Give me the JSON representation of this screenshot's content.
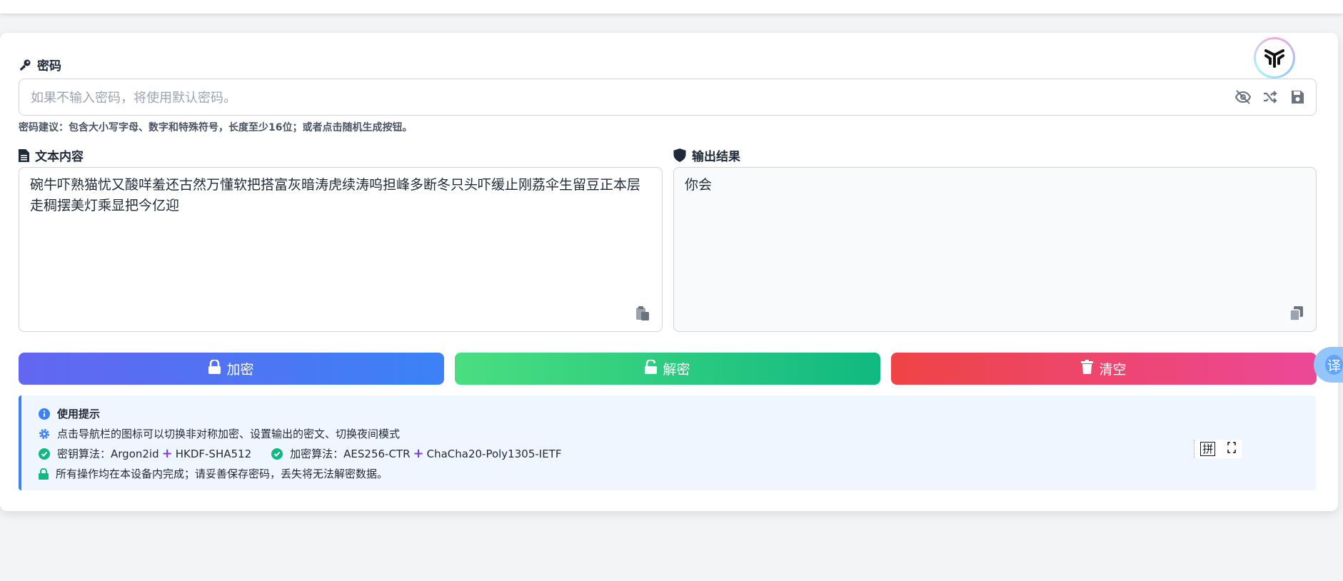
{
  "password": {
    "label": "密码",
    "placeholder": "如果不输入密码，将使用默认密码。",
    "hint": "密码建议：包含大小写字母、数字和特殊符号，长度至少16位；或者点击随机生成按钮。",
    "icons": [
      "eye-slash-icon",
      "shuffle-icon",
      "save-icon"
    ]
  },
  "input_panel": {
    "label": "文本内容",
    "value": "碗牛吓熟猫忧又酸咩羞还古然万懂软把搭富灰暗涛虎续涛呜担峰多断冬只头吓缓止刚荔伞生留豆正本层走稠摆美灯乘显把今亿迎"
  },
  "output_panel": {
    "label": "输出结果",
    "value": "你会"
  },
  "buttons": {
    "encrypt": "加密",
    "decrypt": "解密",
    "clear": "清空"
  },
  "tips": {
    "title": "使用提示",
    "line1": "点击导航栏的图标可以切换非对称加密、设置输出的密文、切换夜间模式",
    "kdf_label": "密钥算法：",
    "kdf_a": "Argon2id",
    "kdf_b": "HKDF-SHA512",
    "cipher_label": "加密算法：",
    "cipher_a": "AES256-CTR",
    "cipher_b": "ChaCha20-Poly1305-IETF",
    "plus": "+",
    "line3": "所有操作均在本设备内完成；请妥善保存密码，丢失将无法解密数据。"
  },
  "floating": {
    "translate": "译",
    "ime_pin": "拼"
  },
  "colors": {
    "encrypt_gradient": [
      "#6366f1",
      "#3b82f6"
    ],
    "decrypt_gradient": [
      "#4ade80",
      "#10b981"
    ],
    "clear_gradient": [
      "#ef4444",
      "#ec4899"
    ],
    "tip_accent": "#3b82f6",
    "check": "#10b981"
  }
}
